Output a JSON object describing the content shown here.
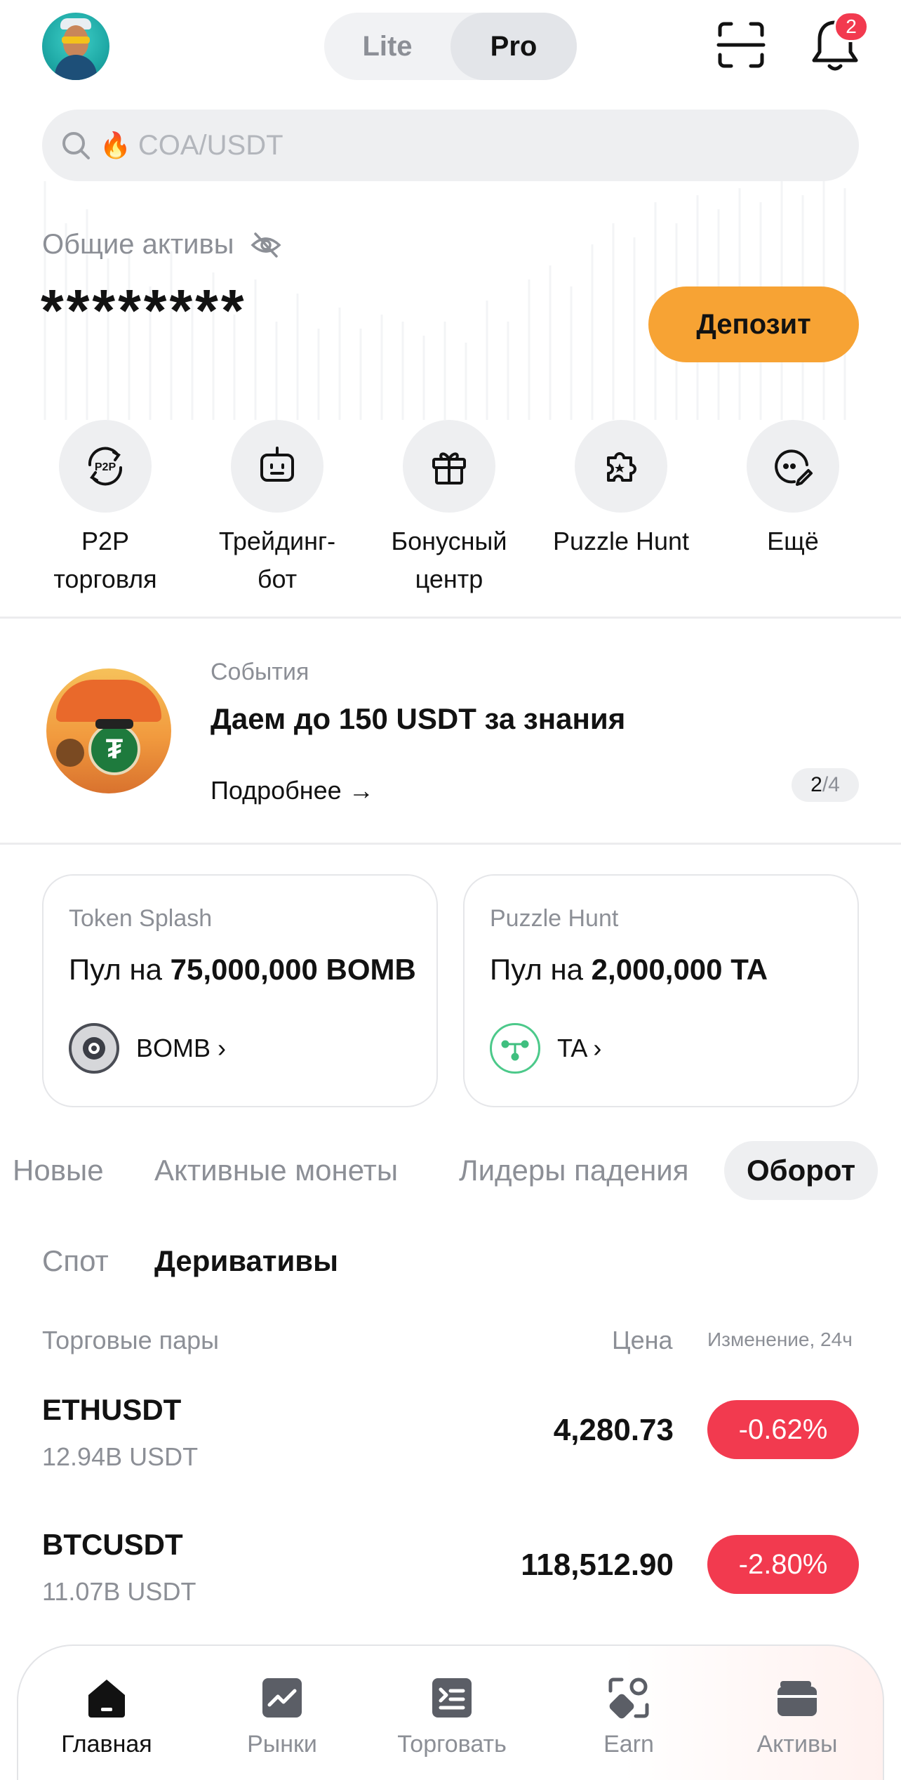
{
  "header": {
    "mode_lite": "Lite",
    "mode_pro": "Pro",
    "notifications_count": "2"
  },
  "search": {
    "placeholder": "COA/USDT",
    "hot_icon": "fire-emoji"
  },
  "assets": {
    "label": "Общие активы",
    "value_masked": "********",
    "deposit_label": "Депозит"
  },
  "shortcuts": [
    {
      "label_line1": "P2P",
      "label_line2": "торговля",
      "icon": "p2p-icon"
    },
    {
      "label_line1": "Трейдинг-",
      "label_line2": "бот",
      "icon": "robot-icon"
    },
    {
      "label_line1": "Бонусный",
      "label_line2": "центр",
      "icon": "gift-icon"
    },
    {
      "label_line1": "Puzzle Hunt",
      "label_line2": "",
      "icon": "puzzle-icon"
    },
    {
      "label_line1": "Ещё",
      "label_line2": "",
      "icon": "more-icon"
    }
  ],
  "event": {
    "category": "События",
    "title": "Даем до 150 USDT за знания",
    "more_label": "Подробнее →",
    "page_current": "2",
    "page_total": "/4"
  },
  "promos": [
    {
      "category": "Token Splash",
      "pool_prefix": "Пул на",
      "pool_amount": "75,000,000 BOMB",
      "token": "BOMB ›"
    },
    {
      "category": "Puzzle Hunt",
      "pool_prefix": "Пул на",
      "pool_amount": "2,000,000 TA",
      "token": "TA ›"
    }
  ],
  "tabs": [
    "Новые",
    "Активные монеты",
    "Лидеры падения",
    "Оборот"
  ],
  "active_tab": "Оборот",
  "subtabs": [
    "Спот",
    "Деривативы"
  ],
  "active_subtab": "Деривативы",
  "table": {
    "col_pair": "Торговые пары",
    "col_price": "Цена",
    "col_change": "Изменение, 24ч",
    "rows": [
      {
        "symbol": "ETHUSDT",
        "volume": "12.94B USDT",
        "price": "4,280.73",
        "change": "-0.62%"
      },
      {
        "symbol": "BTCUSDT",
        "volume": "11.07B USDT",
        "price": "118,512.90",
        "change": "-2.80%"
      }
    ]
  },
  "bottom_nav": [
    {
      "label": "Главная",
      "icon": "home-icon",
      "active": true
    },
    {
      "label": "Рынки",
      "icon": "chart-icon",
      "active": false
    },
    {
      "label": "Торговать",
      "icon": "trade-icon",
      "active": false
    },
    {
      "label": "Earn",
      "icon": "earn-icon",
      "active": false
    },
    {
      "label": "Активы",
      "icon": "wallet-icon",
      "active": false
    }
  ],
  "colors": {
    "accent_orange": "#f7a334",
    "negative_red": "#f23a4f",
    "muted_text": "#8c8f96"
  }
}
